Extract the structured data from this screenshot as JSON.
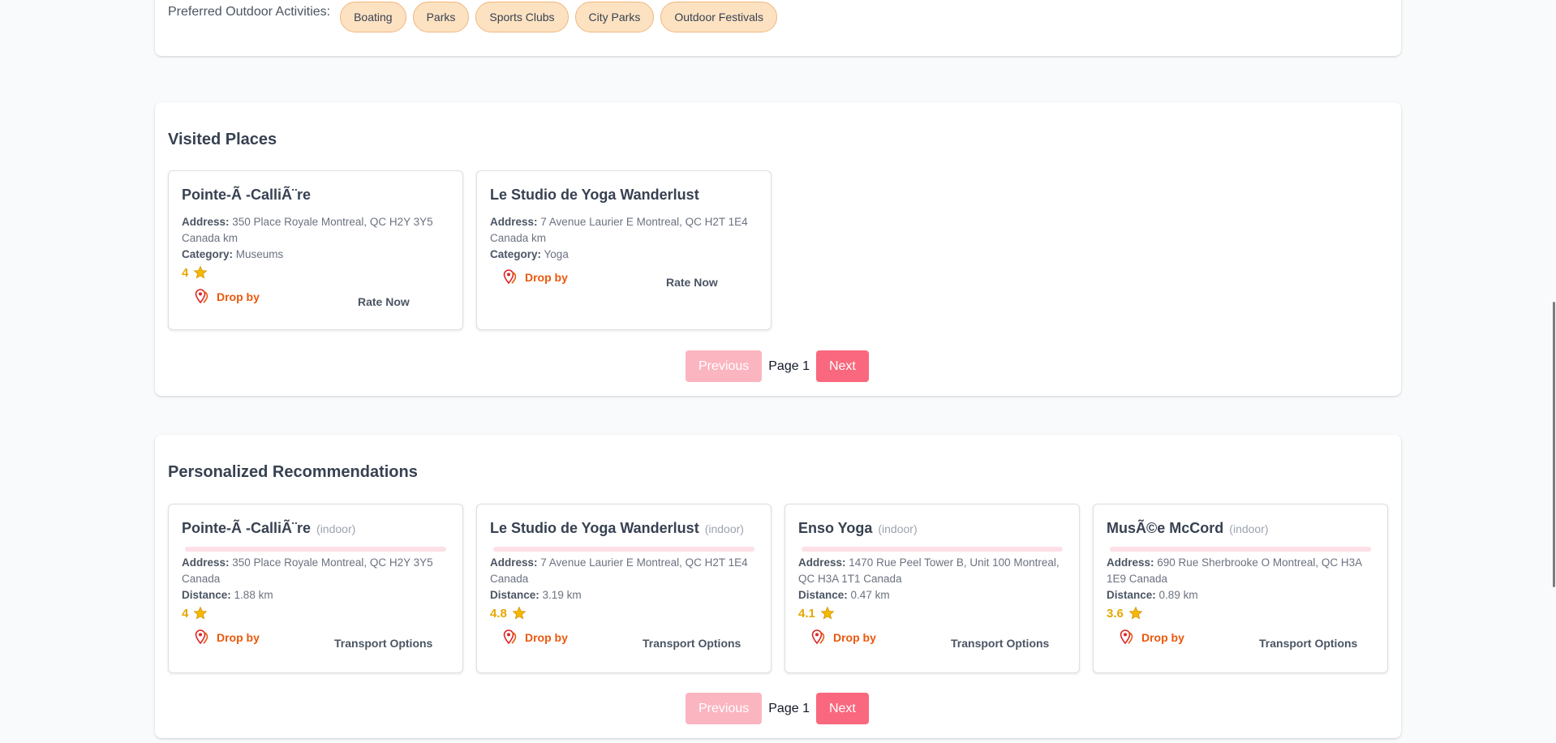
{
  "preferences": {
    "label": "Preferred Outdoor Activities:",
    "activities": [
      "Boating",
      "Parks",
      "Sports Clubs",
      "City Parks",
      "Outdoor Festivals"
    ]
  },
  "visited": {
    "title": "Visited Places",
    "places": [
      {
        "name": "Pointe-Ã -CalliÃ¨re",
        "address_label": "Address:",
        "address": "350 Place Royale Montreal, QC H2Y 3Y5 Canada km",
        "category_label": "Category:",
        "category": "Museums",
        "rating": "4",
        "drop_by": "Drop by",
        "action": "Rate Now"
      },
      {
        "name": "Le Studio de Yoga Wanderlust",
        "address_label": "Address:",
        "address": "7 Avenue Laurier E Montreal, QC H2T 1E4 Canada km",
        "category_label": "Category:",
        "category": "Yoga",
        "drop_by": "Drop by",
        "action": "Rate Now"
      }
    ],
    "pager": {
      "prev": "Previous",
      "page": "Page 1",
      "next": "Next"
    }
  },
  "recommendations": {
    "title": "Personalized Recommendations",
    "items": [
      {
        "name": "Pointe-Ã -CalliÃ¨re",
        "tag": "(indoor)",
        "address_label": "Address:",
        "address": "350 Place Royale Montreal, QC H2Y 3Y5 Canada",
        "distance_label": "Distance:",
        "distance": "1.88 km",
        "rating": "4",
        "drop_by": "Drop by",
        "action": "Transport Options"
      },
      {
        "name": "Le Studio de Yoga Wanderlust",
        "tag": "(indoor)",
        "address_label": "Address:",
        "address": "7 Avenue Laurier E Montreal, QC H2T 1E4 Canada",
        "distance_label": "Distance:",
        "distance": "3.19 km",
        "rating": "4.8",
        "drop_by": "Drop by",
        "action": "Transport Options"
      },
      {
        "name": "Enso Yoga",
        "tag": "(indoor)",
        "address_label": "Address:",
        "address": "1470 Rue Peel Tower B, Unit 100 Montreal, QC H3A 1T1 Canada",
        "distance_label": "Distance:",
        "distance": "0.47 km",
        "rating": "4.1",
        "drop_by": "Drop by",
        "action": "Transport Options"
      },
      {
        "name": "MusÃ©e McCord",
        "tag": "(indoor)",
        "address_label": "Address:",
        "address": "690 Rue Sherbrooke O Montreal, QC H3A 1E9 Canada",
        "distance_label": "Distance:",
        "distance": "0.89 km",
        "rating": "3.6",
        "drop_by": "Drop by",
        "action": "Transport Options"
      }
    ],
    "pager": {
      "prev": "Previous",
      "page": "Page 1",
      "next": "Next"
    }
  },
  "colors": {
    "pill_bg": "#fde2c2",
    "pill_border": "#f0b77e",
    "accent_orange": "#ea580c",
    "rating_gold": "#e6a700",
    "next_button": "#f9687e",
    "prev_button_disabled": "#fbb5c0"
  },
  "icons": {
    "rating": "star-icon",
    "drop_by": "map-pin-icon"
  }
}
